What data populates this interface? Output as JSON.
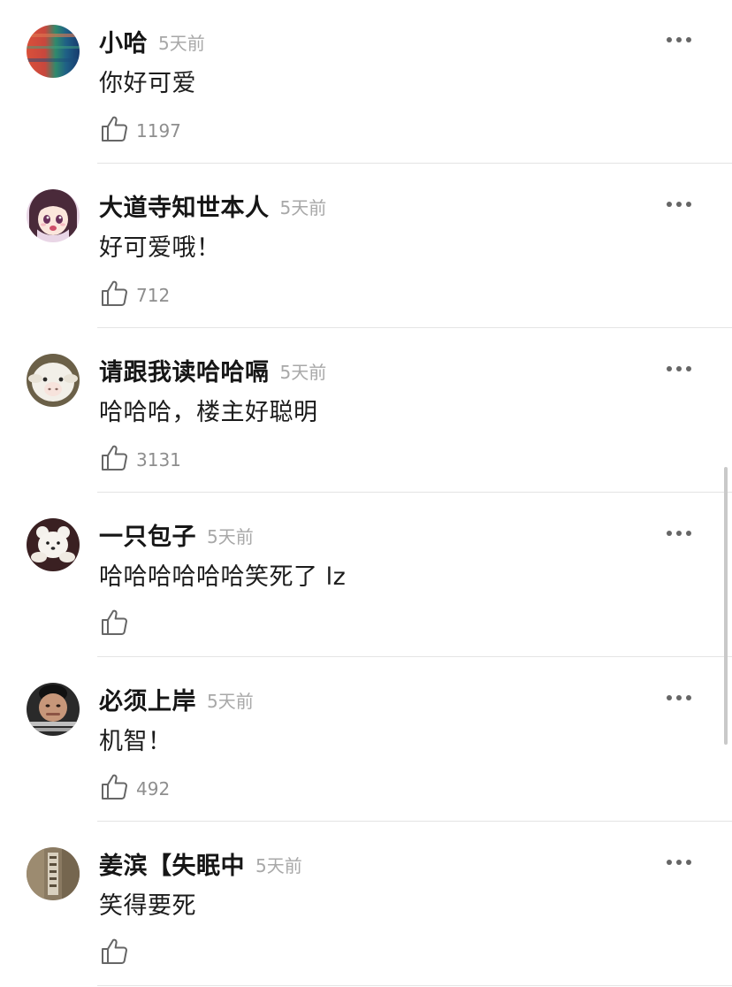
{
  "comments": [
    {
      "username": "小哈",
      "time": "5天前",
      "text": "你好可爱",
      "likes": "1197",
      "avatar": "colorful-gradient-avatar"
    },
    {
      "username": "大道寺知世本人",
      "time": "5天前",
      "text": "好可爱哦！",
      "likes": "712",
      "avatar": "anime-girl-avatar"
    },
    {
      "username": "请跟我读哈哈嗝",
      "time": "5天前",
      "text": "哈哈哈，楼主好聪明",
      "likes": "3131",
      "avatar": "sheep-avatar"
    },
    {
      "username": "一只包子",
      "time": "5天前",
      "text": "哈哈哈哈哈哈笑死了 lz",
      "likes": "",
      "avatar": "plush-bear-avatar"
    },
    {
      "username": "必须上岸",
      "time": "5天前",
      "text": "机智！",
      "likes": "492",
      "avatar": "meme-person-avatar"
    },
    {
      "username": "姜滨【失眠中",
      "time": "5天前",
      "text": "笑得要死",
      "likes": "",
      "avatar": "photo-avatar"
    }
  ],
  "colors": {
    "text": "#1c1c1c",
    "time": "#a8a8a8",
    "like_count": "#8e8e8e",
    "divider": "#e4e4e4",
    "icon": "#666666"
  }
}
